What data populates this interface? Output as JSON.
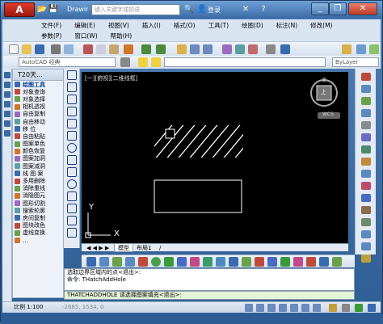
{
  "app": {
    "logo_text": "A",
    "document_title": "Drawing1.d..."
  },
  "search": {
    "placeholder": "键入关键字或短语"
  },
  "user": {
    "login_label": "登录"
  },
  "window_controls": {
    "minimize": "_",
    "restore": "❐",
    "close": "✕"
  },
  "menubar": {
    "row1": [
      "文件(F)",
      "编辑(E)",
      "视图(V)",
      "插入(I)",
      "格式(O)",
      "工具(T)",
      "绘图(D)",
      "标注(N)",
      "修改(M)"
    ],
    "row2": [
      "参数(P)",
      "窗口(W)",
      "帮助(H)"
    ]
  },
  "toolbar": {
    "workspace": "AutoCAD 经典",
    "layer_combo": "ByLayer"
  },
  "left_panel": {
    "title": "T20天...",
    "items": [
      {
        "label": "绘图工具",
        "section": true
      },
      {
        "label": "对象查询"
      },
      {
        "label": "对象选择"
      },
      {
        "label": "相机透视"
      },
      {
        "label": "自由复制"
      },
      {
        "label": "自由移动"
      },
      {
        "label": "移    位"
      },
      {
        "label": "自由粘贴"
      },
      {
        "label": "图案单色"
      },
      {
        "label": "颜色恢复"
      },
      {
        "label": "图案加洞"
      },
      {
        "label": "图案减洞"
      },
      {
        "label": "线 图 案"
      },
      {
        "label": "多用删除"
      },
      {
        "label": "消除重线"
      },
      {
        "label": "消隐图元"
      },
      {
        "label": "图形切割"
      },
      {
        "label": "搜索轮廓"
      },
      {
        "label": "房间复制"
      },
      {
        "label": "图块改色"
      },
      {
        "label": "虚线变换"
      },
      {
        "label": "…"
      }
    ]
  },
  "viewport": {
    "label": "[一][俯视][二维线框]",
    "wcs_label": "WCS",
    "compass_top": "北",
    "compass_center": "上",
    "axis_y": "Y",
    "axis_x": "X"
  },
  "tabs": [
    {
      "label": "模型",
      "active": true
    },
    {
      "label": "布局1",
      "active": false
    },
    {
      "label": "/",
      "active": false
    }
  ],
  "command": {
    "history": [
      "选取边界区域内的点<退出>:",
      "命令: THatchAddHole"
    ],
    "prompt": "THATCHADDHOLE 请选择图案填充<退出>:"
  },
  "status": {
    "scale": "比例 1:100",
    "coords": "-2685, 1534, 0"
  },
  "colors": {
    "canvas": "#000000",
    "hatch": "#ffffff",
    "title_gradient": "#3a6aa3",
    "menubar": "#d9e4f1"
  }
}
